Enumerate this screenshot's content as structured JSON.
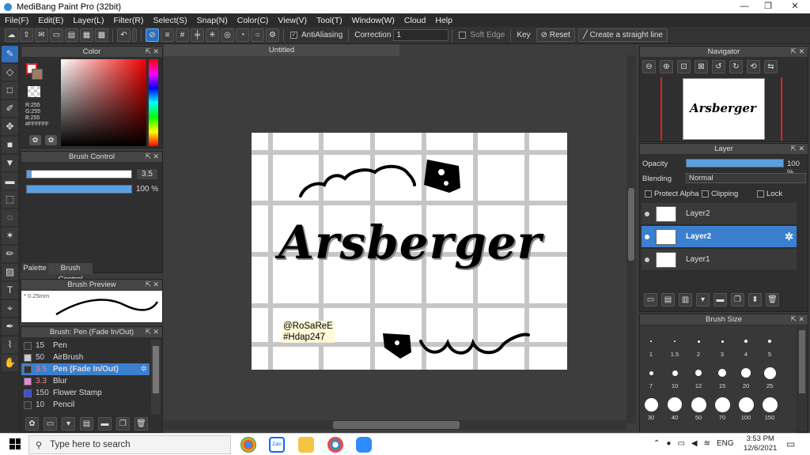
{
  "window": {
    "title": "MediBang Paint Pro (32bit)",
    "minimize": "—",
    "maximize": "❐",
    "close": "✕"
  },
  "menu": [
    "File(F)",
    "Edit(E)",
    "Layer(L)",
    "Filter(R)",
    "Select(S)",
    "Snap(N)",
    "Color(C)",
    "View(V)",
    "Tool(T)",
    "Window(W)",
    "Cloud",
    "Help"
  ],
  "toolbar": {
    "antialiasing_label": "AntiAliasing",
    "correction_label": "Correction",
    "correction_value": "1",
    "soft_edge_label": "Soft Edge",
    "key_label": "Key",
    "reset_label": "Reset",
    "straight_line_label": "Create a straight line"
  },
  "color_panel": {
    "title": "Color",
    "r": "R:255",
    "g": "G:255",
    "b": "B:255",
    "hex": "#FFFFFF"
  },
  "brush_control": {
    "title": "Brush Control",
    "size": "3.5",
    "opacity": "100 %"
  },
  "tabs": {
    "palette": "Palette",
    "brush_control": "Brush Control"
  },
  "brush_preview": {
    "title": "Brush Preview",
    "size": "0.25mm"
  },
  "brush_list": {
    "title": "Brush: Pen (Fade In/Out)",
    "items": [
      {
        "num": "15",
        "name": "Pen",
        "color": "#333333"
      },
      {
        "num": "50",
        "name": "AirBrush",
        "color": "#cccccc"
      },
      {
        "num": "3.5",
        "name": "Pen (Fade In/Out)",
        "color": "#333333"
      },
      {
        "num": "3.3",
        "name": "Blur",
        "color": "#e68ad8"
      },
      {
        "num": "150",
        "name": "Flower Stamp",
        "color": "#3a4fd9"
      },
      {
        "num": "10",
        "name": "Pencil",
        "color": "#333333"
      }
    ]
  },
  "document": {
    "tab": "Untitled"
  },
  "artwork": {
    "title": "Arsberger",
    "credit1": "@RoSaReE",
    "credit2": "#Hdap247"
  },
  "navigator": {
    "title": "Navigator"
  },
  "layer_panel": {
    "title": "Layer",
    "opacity_label": "Opacity",
    "opacity_value": "100 %",
    "blending_label": "Blending",
    "blending_value": "Normal",
    "protect_alpha": "Protect Alpha",
    "clipping": "Clipping",
    "lock": "Lock",
    "layers": [
      {
        "name": "Layer2",
        "selected": false
      },
      {
        "name": "Layer2",
        "selected": true
      },
      {
        "name": "Layer1",
        "selected": false
      }
    ]
  },
  "brush_size": {
    "title": "Brush Size",
    "sizes": [
      "1",
      "1.5",
      "2",
      "3",
      "4",
      "5",
      "7",
      "10",
      "12",
      "15",
      "20",
      "25",
      "30",
      "40",
      "50",
      "70",
      "100",
      "150"
    ]
  },
  "taskbar": {
    "search_placeholder": "Type here to search",
    "time": "3:53 PM",
    "date": "12/6/2021",
    "lang": "ENG"
  }
}
